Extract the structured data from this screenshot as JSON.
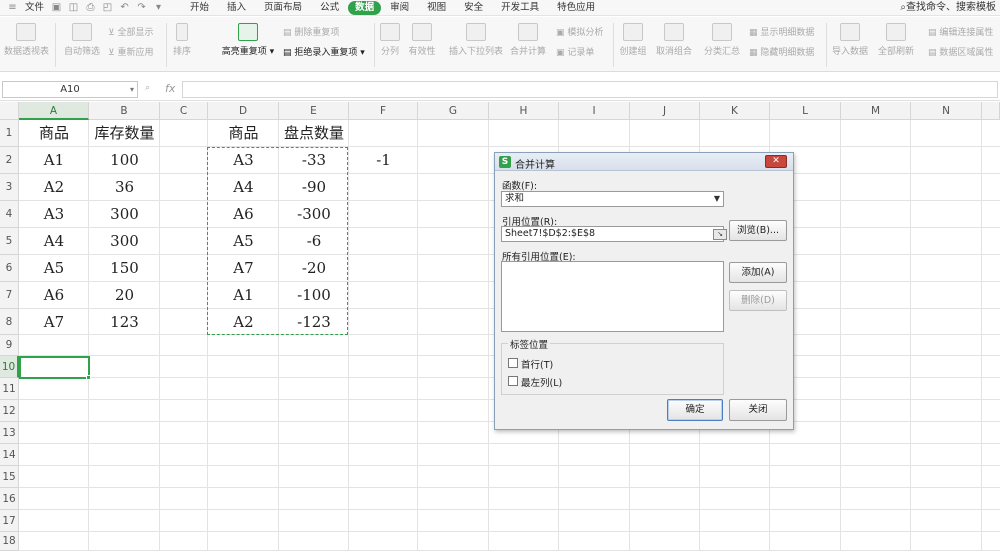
{
  "menubar": {
    "file_label": "文件",
    "tabs": [
      "开始",
      "插入",
      "页面布局",
      "公式",
      "数据",
      "审阅",
      "视图",
      "安全",
      "开发工具",
      "特色应用"
    ],
    "active_tab": "数据",
    "search_label": "查找命令、搜索模板"
  },
  "ribbon": {
    "pivot": "数据透视表",
    "auto_filter": "自动筛选",
    "show_all": "全部显示",
    "reapply": "重新应用",
    "sort": "排序",
    "highlight_dup": "高亮重复项",
    "delete_dup": "删除重复项",
    "reject_dup": "拒绝录入重复项",
    "split": "分列",
    "validity": "有效性",
    "dropdown": "插入下拉列表",
    "consolidate": "合并计算",
    "simulate": "模拟分析",
    "record": "记录单",
    "create_group": "创建组",
    "ungroup": "取消组合",
    "subtotal": "分类汇总",
    "show_detail": "显示明细数据",
    "hide_detail": "隐藏明细数据",
    "import": "导入数据",
    "refresh_all": "全部刷新",
    "edit_links": "编辑连接属性",
    "range_props": "数据区域属性"
  },
  "formula_bar": {
    "name_box": "A10",
    "fx": "fx",
    "formula": ""
  },
  "columns": [
    "A",
    "B",
    "C",
    "D",
    "E",
    "F",
    "G",
    "H",
    "I",
    "J",
    "K",
    "L",
    "M",
    "N"
  ],
  "rows": [
    "1",
    "2",
    "3",
    "4",
    "5",
    "6",
    "7",
    "8",
    "9",
    "10",
    "11",
    "12",
    "13",
    "14",
    "15",
    "16",
    "17",
    "18"
  ],
  "selected_column": "A",
  "selected_row": "10",
  "sheet": {
    "A1": "商品",
    "B1": "库存数量",
    "D1": "商品",
    "E1": "盘点数量",
    "A2": "A1",
    "B2": "100",
    "D2": "A3",
    "E2": "-33",
    "F2": "-1",
    "A3": "A2",
    "B3": "36",
    "D3": "A4",
    "E3": "-90",
    "A4": "A3",
    "B4": "300",
    "D4": "A6",
    "E4": "-300",
    "A5": "A4",
    "B5": "300",
    "D5": "A5",
    "E5": "-6",
    "A6": "A5",
    "B6": "150",
    "D6": "A7",
    "E6": "-20",
    "A7": "A6",
    "B7": "20",
    "D7": "A1",
    "E7": "-100",
    "A8": "A7",
    "B8": "123",
    "D8": "A2",
    "E8": "-123"
  },
  "dialog": {
    "title": "合并计算",
    "close": "✕",
    "function_label": "函数(F):",
    "function_value": "求和",
    "reference_label": "引用位置(R):",
    "reference_value": "Sheet7!$D$2:$E$8",
    "browse": "浏览(B)...",
    "all_refs_label": "所有引用位置(E):",
    "add": "添加(A)",
    "delete": "删除(D)",
    "label_group": "标签位置",
    "first_row": "首行(T)",
    "left_column": "最左列(L)",
    "ok": "确定",
    "cancel": "关闭"
  },
  "colors": {
    "accent": "#31a14b"
  }
}
